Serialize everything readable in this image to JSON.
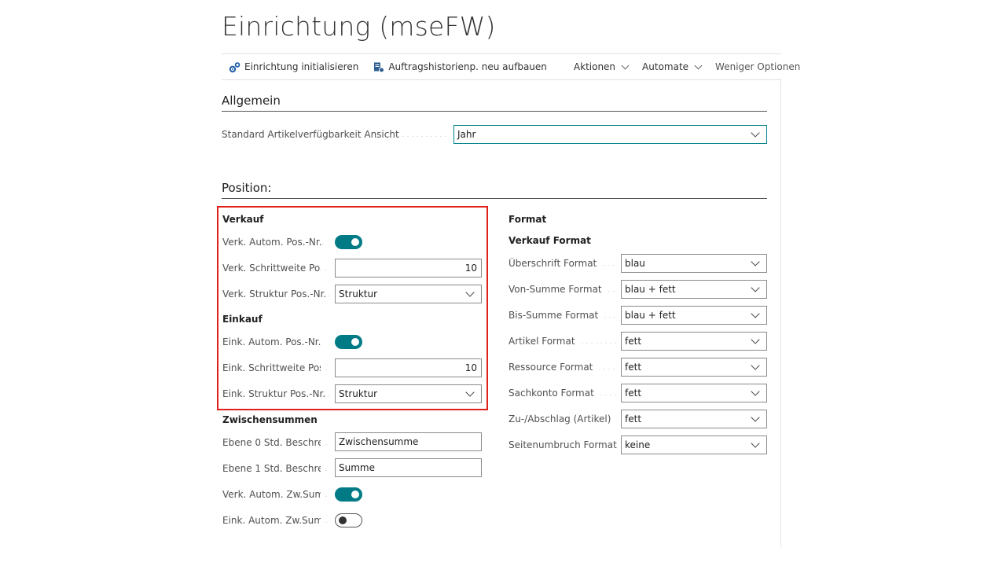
{
  "page": {
    "title": "Einrichtung (mseFW)"
  },
  "actions": {
    "init": "Einrichtung initialisieren",
    "rebuild": "Auftragshistorienp. neu aufbauen",
    "aktionen": "Aktionen",
    "automate": "Automate",
    "weniger": "Weniger Optionen"
  },
  "allgemein": {
    "title": "Allgemein",
    "ansicht_label": "Standard Artikelverfügbarkeit Ansicht",
    "ansicht_value": "Jahr"
  },
  "position": {
    "title": "Position:",
    "verkauf": {
      "heading": "Verkauf",
      "auto_label": "Verk. Autom. Pos.-Nr....",
      "auto_on": true,
      "step_label": "Verk. Schrittweite Pos...",
      "step_value": "10",
      "struct_label": "Verk. Struktur Pos.-Nr.",
      "struct_value": "Struktur"
    },
    "einkauf": {
      "heading": "Einkauf",
      "auto_label": "Eink. Autom. Pos.-Nr. ...",
      "auto_on": true,
      "step_label": "Eink. Schrittweite Pos...",
      "step_value": "10",
      "struct_label": "Eink. Struktur Pos.-Nr.",
      "struct_value": "Struktur"
    },
    "zwischensummen": {
      "heading": "Zwischensummen",
      "ebene0_label": "Ebene 0 Std. Beschrei...",
      "ebene0_value": "Zwischensumme",
      "ebene1_label": "Ebene 1 Std. Beschrei...",
      "ebene1_value": "Summe",
      "verk_label": "Verk. Autom. Zw.Sum...",
      "verk_on": true,
      "eink_label": "Eink. Autom. Zw.Sum...",
      "eink_on": false
    },
    "format": {
      "heading": "Format",
      "subheading": "Verkauf Format",
      "rows": [
        {
          "label": "Überschrift Format",
          "value": "blau"
        },
        {
          "label": "Von-Summe Format",
          "value": "blau + fett"
        },
        {
          "label": "Bis-Summe Format",
          "value": "blau + fett"
        },
        {
          "label": "Artikel Format",
          "value": "fett"
        },
        {
          "label": "Ressource Format",
          "value": "fett"
        },
        {
          "label": "Sachkonto Format",
          "value": "fett"
        },
        {
          "label": "Zu-/Abschlag (Artikel)",
          "value": "fett"
        },
        {
          "label": "Seitenumbruch Format",
          "value": "keine"
        }
      ]
    }
  },
  "colors": {
    "accent": "#007b85",
    "highlight": "#e0201b"
  }
}
